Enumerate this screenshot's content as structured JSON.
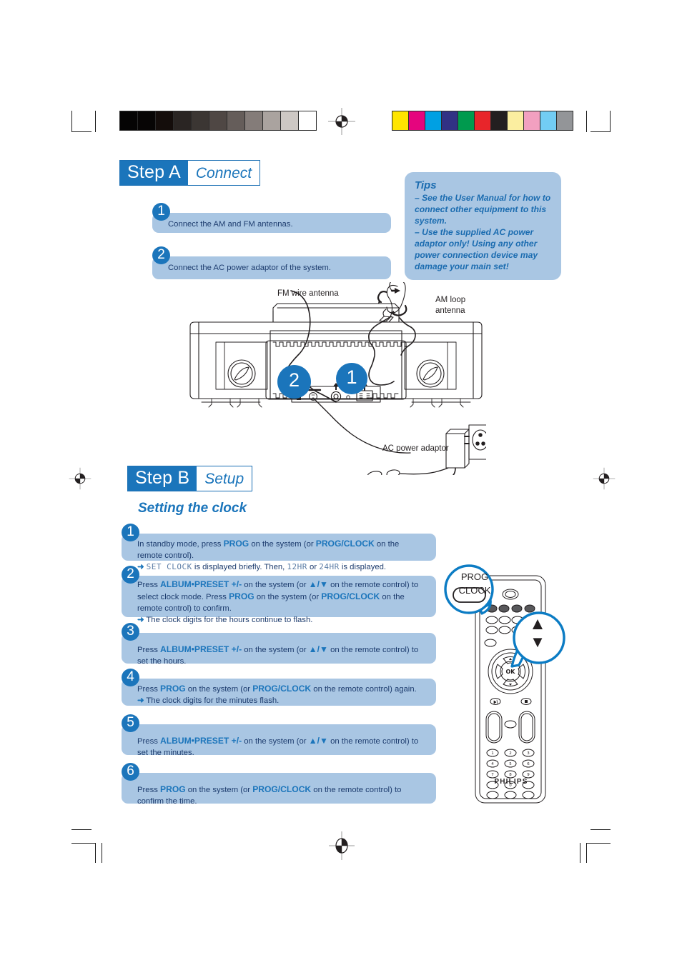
{
  "document": {
    "title": "Philips Quick Start Guide — Step A Connect / Step B Setup"
  },
  "printer_marks": {
    "grey_ramp": [
      "#050404",
      "#070505",
      "#140d0b",
      "#2a2523",
      "#3b3633",
      "#4f4744",
      "#655d5a",
      "#847c79",
      "#aaa39f",
      "#cdc8c4",
      "#ffffff"
    ],
    "color_patches": [
      "#ffe500",
      "#e5057e",
      "#00a0e3",
      "#313184",
      "#009a4e",
      "#e8252a",
      "#231f20",
      "#fbeea0",
      "#f2a0c0",
      "#72cdf4",
      "#939598"
    ]
  },
  "step_a": {
    "label": "Step A",
    "sub": "Connect",
    "items": [
      {
        "num": "1",
        "text": "Connect the AM and FM antennas."
      },
      {
        "num": "2",
        "text": "Connect the AC power adaptor of the system."
      }
    ]
  },
  "tips": {
    "title": "Tips",
    "lines": [
      "–  See the User Manual for how to connect other equipment to this system.",
      "–  Use the supplied AC power adaptor only! Using any other power connection device may damage your main set!"
    ]
  },
  "diagram": {
    "fm_label": "FM wire antenna",
    "am_label": "AM loop\nantenna",
    "am_label_line1": "AM loop",
    "am_label_line2": "antenna",
    "ac_label": "AC power adaptor",
    "callout_1": "1",
    "callout_2": "2"
  },
  "step_b": {
    "label": "Step B",
    "sub": "Setup",
    "section_title": "Setting the clock",
    "items": [
      {
        "num": "1",
        "parts": [
          {
            "t": "In standby mode, press ",
            "k": "n"
          },
          {
            "t": "PROG",
            "k": "b"
          },
          {
            "t": " on the system (or ",
            "k": "n"
          },
          {
            "t": "PROG/CLOCK",
            "k": "b"
          },
          {
            "t": " on the remote control).",
            "k": "n"
          }
        ],
        "result_pre": "SET CLOCK",
        "result_mid": " is displayed briefly. Then, ",
        "result_lcd1": "12HR",
        "result_or": " or ",
        "result_lcd2": "24HR",
        "result_end": " is displayed."
      },
      {
        "num": "2",
        "parts": [
          {
            "t": "Press ",
            "k": "n"
          },
          {
            "t": "ALBUM•PRESET +/-",
            "k": "b"
          },
          {
            "t": "  on the system (or ",
            "k": "n"
          },
          {
            "t": "▲/▼",
            "k": "b"
          },
          {
            "t": "  on the remote control) to select clock mode. Press ",
            "k": "n"
          },
          {
            "t": "PROG",
            "k": "b"
          },
          {
            "t": " on the system (or ",
            "k": "n"
          },
          {
            "t": "PROG/CLOCK",
            "k": "b"
          },
          {
            "t": " on the remote control) to confirm.",
            "k": "n"
          }
        ],
        "result": "The clock digits for the hours continue to flash."
      },
      {
        "num": "3",
        "parts": [
          {
            "t": "Press ",
            "k": "n"
          },
          {
            "t": "ALBUM•PRESET +/-",
            "k": "b"
          },
          {
            "t": "  on the system (or ",
            "k": "n"
          },
          {
            "t": "▲/▼",
            "k": "b"
          },
          {
            "t": " on the remote control) to set the hours.",
            "k": "n"
          }
        ],
        "result": ""
      },
      {
        "num": "4",
        "parts": [
          {
            "t": "Press ",
            "k": "n"
          },
          {
            "t": "PROG",
            "k": "b"
          },
          {
            "t": " on the system (or ",
            "k": "n"
          },
          {
            "t": "PROG/CLOCK",
            "k": "b"
          },
          {
            "t": " on the remote control) again.",
            "k": "n"
          }
        ],
        "result": "The clock digits for the minutes flash."
      },
      {
        "num": "5",
        "parts": [
          {
            "t": "Press ",
            "k": "n"
          },
          {
            "t": "ALBUM•PRESET +/-",
            "k": "b"
          },
          {
            "t": " on the system (or ",
            "k": "n"
          },
          {
            "t": "▲/▼",
            "k": "b"
          },
          {
            "t": " on the remote control) to set the minutes.",
            "k": "n"
          }
        ],
        "result": ""
      },
      {
        "num": "6",
        "parts": [
          {
            "t": "Press  ",
            "k": "n"
          },
          {
            "t": "PROG",
            "k": "b"
          },
          {
            "t": " on the system (or ",
            "k": "n"
          },
          {
            "t": "PROG/CLOCK",
            "k": "b"
          },
          {
            "t": " on the remote control) to confirm the time.",
            "k": "n"
          }
        ],
        "result": ""
      }
    ]
  },
  "remote": {
    "brand": "PHILIPS",
    "callout_prog": "PROG",
    "callout_clock": "CLOCK",
    "callout_up": "▲",
    "callout_down": "▼",
    "ok_label": "OK",
    "keys": [
      "1",
      "2",
      "3",
      "4",
      "5",
      "6",
      "7",
      "8",
      "9",
      "0"
    ]
  },
  "colors": {
    "brand_blue": "#1b75bb",
    "panel_blue": "#a9c6e3",
    "text_navy": "#1d3c6e",
    "line_dark": "#231f20"
  }
}
